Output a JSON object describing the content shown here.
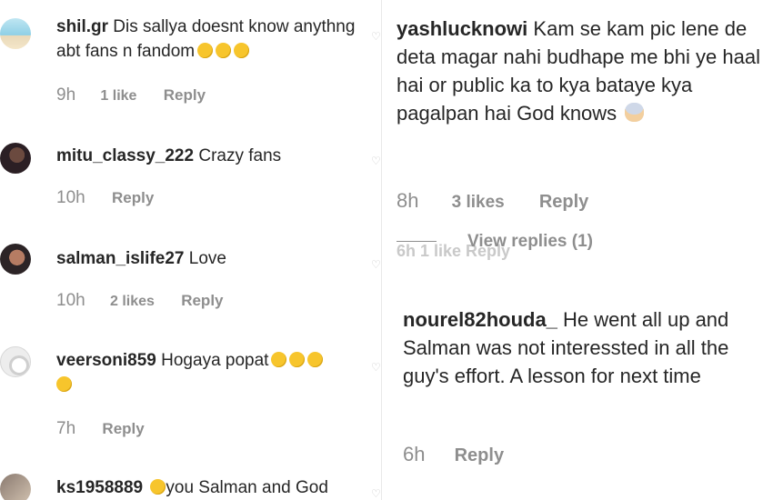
{
  "left_comments": [
    {
      "username": "shil.gr",
      "text": "Dis sallya doesnt know anythng abt fans n fandom",
      "emojis": [
        "frown-emoji",
        "frown-emoji",
        "frown-emoji"
      ],
      "time": "9h",
      "likes": "1 like",
      "reply": "Reply"
    },
    {
      "username": "mitu_classy_222",
      "text": "Crazy fans",
      "time": "10h",
      "likes": "",
      "reply": "Reply"
    },
    {
      "username": "salman_islife27",
      "text": "Love",
      "time": "10h",
      "likes": "2 likes",
      "reply": "Reply"
    },
    {
      "username": "veersoni859",
      "text": "Hogaya popat",
      "emojis": [
        "grin-emoji",
        "grin-emoji",
        "grin-emoji",
        "grin-emoji"
      ],
      "time": "7h",
      "likes": "",
      "reply": "Reply"
    },
    {
      "username": "ks1958889",
      "text": "you Salman and God",
      "emojis": [
        "smile-emoji"
      ],
      "time": "",
      "likes": "",
      "reply": ""
    }
  ],
  "right_comments": [
    {
      "username": "yashlucknowi",
      "text": "Kam se kam pic lene de deta magar nahi budhape me bhi ye haal hai or public ka to kya bataye kya pagalpan hai God knows",
      "emoji": "scream-emoji",
      "time": "8h",
      "likes": "3 likes",
      "reply": "Reply",
      "view_replies": "View replies (1)",
      "ghost": "6h   1 like   Reply"
    },
    {
      "username": "nourel82houda_",
      "text": "He went all up and Salman was not interessted in all the guy's effort. A lesson for next time",
      "time": "6h",
      "likes": "",
      "reply": "Reply"
    }
  ],
  "icons": {
    "heart": "heart-icon"
  },
  "colors": {
    "text": "#262626",
    "muted": "#8e8e8e",
    "background": "#ffffff"
  }
}
